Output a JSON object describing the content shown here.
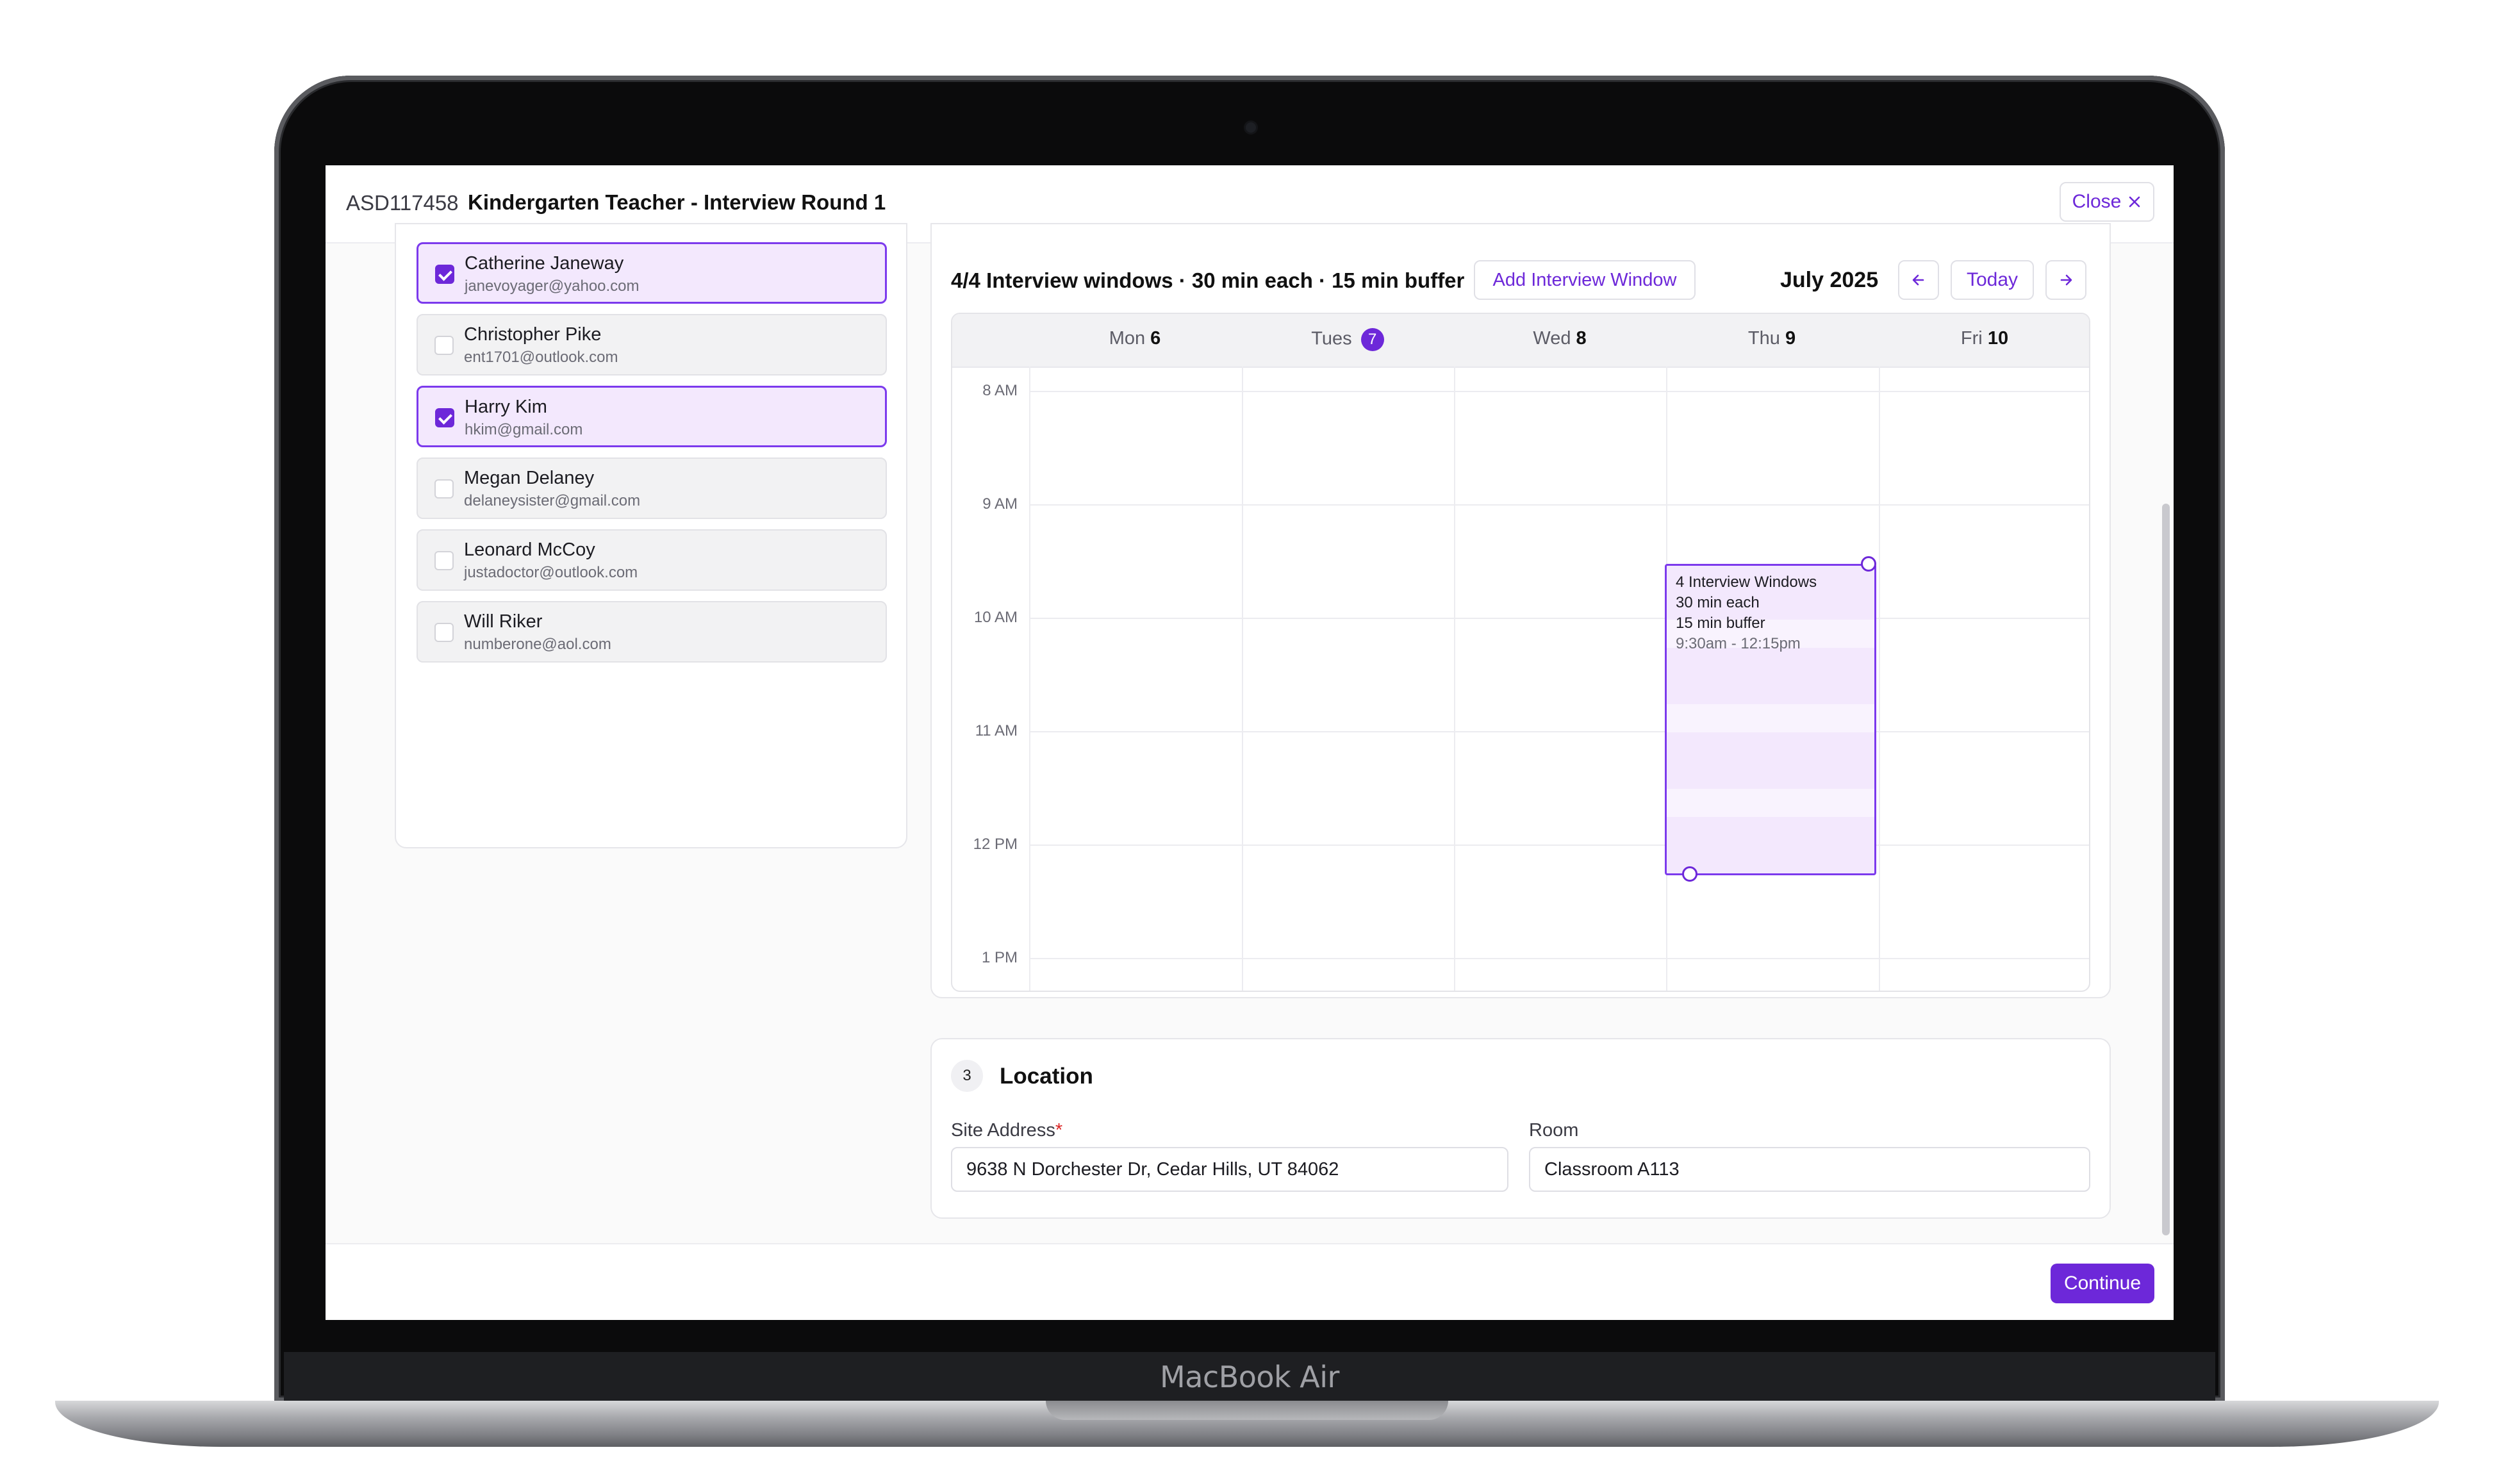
{
  "device": {
    "label": "MacBook Air"
  },
  "header": {
    "job_id": "ASD117458",
    "job_title": "Kindergarten Teacher - Interview Round 1",
    "close_label": "Close",
    "close_icon": "close-icon"
  },
  "applicants": [
    {
      "name": "Catherine Janeway",
      "email": "janevoyager@yahoo.com",
      "selected": true
    },
    {
      "name": "Christopher Pike",
      "email": "ent1701@outlook.com",
      "selected": false
    },
    {
      "name": "Harry Kim",
      "email": "hkim@gmail.com",
      "selected": true
    },
    {
      "name": "Megan Delaney",
      "email": "delaneysister@gmail.com",
      "selected": false
    },
    {
      "name": "Leonard McCoy",
      "email": "justadoctor@outlook.com",
      "selected": false
    },
    {
      "name": "Will Riker",
      "email": "numberone@aol.com",
      "selected": false
    }
  ],
  "calendar": {
    "summary": "4/4 Interview windows · 30 min each · 15 min buffer",
    "add_window_label": "Add Interview Window",
    "month": "July 2025",
    "today_label": "Today",
    "prev_icon": "arrow-left-icon",
    "next_icon": "arrow-right-icon",
    "days": [
      {
        "name": "Mon",
        "date": "6"
      },
      {
        "name": "Tues",
        "date": "7",
        "is_today": true
      },
      {
        "name": "Wed",
        "date": "8"
      },
      {
        "name": "Thu",
        "date": "9"
      },
      {
        "name": "Fri",
        "date": "10"
      }
    ],
    "times": [
      "8 AM",
      "9 AM",
      "10 AM",
      "11 AM",
      "12 PM",
      "1 PM"
    ],
    "event": {
      "day": "Thu 9",
      "title": "4 Interview Windows",
      "duration": "30 min each",
      "buffer": "15 min buffer",
      "time_range": "9:30am - 12:15pm"
    }
  },
  "location": {
    "step": "3",
    "title": "Location",
    "site_label": "Site Address",
    "required_mark": "*",
    "site_value": "9638 N Dorchester Dr, Cedar Hills, UT 84062",
    "room_label": "Room",
    "room_value": "Classroom A113"
  },
  "footer": {
    "continue_label": "Continue"
  },
  "colors": {
    "accent": "#6d28d9",
    "selected_bg": "#f3e8fd",
    "required": "#dc2626"
  }
}
